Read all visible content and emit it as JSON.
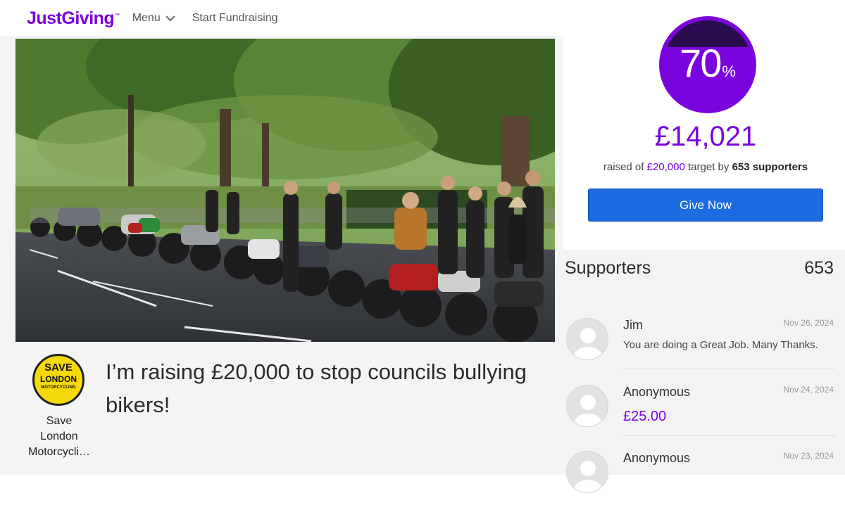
{
  "header": {
    "logo": "JustGiving",
    "logo_tm": "™",
    "menu_label": "Menu",
    "start_label": "Start Fundraising"
  },
  "hero": {
    "image": "group of motorcyclists with motorbikes parked along a tree-lined street"
  },
  "charity": {
    "name_lines": [
      "Save",
      "London",
      "Motorcycli…"
    ],
    "logo_text": [
      "SAVE",
      "LONDON",
      "MOTORCYCLING"
    ]
  },
  "page": {
    "title": "I’m raising £20,000 to stop councils bullying bikers!"
  },
  "progress": {
    "percent": "70",
    "percent_sign": "%",
    "fill_fraction": 0.7,
    "raised": "£14,021",
    "raised_prefix": "raised of",
    "target": "£20,000",
    "middle": "target by",
    "supporters_text": "653 supporters"
  },
  "give_button": "Give Now",
  "supporters": {
    "title": "Supporters",
    "count": "653",
    "items": [
      {
        "name": "Jim",
        "date": "Nov 26, 2024",
        "message": "You are doing a Great Job. Many Thanks.",
        "amount": ""
      },
      {
        "name": "Anonymous",
        "date": "Nov 24, 2024",
        "message": "",
        "amount": "£25.00"
      },
      {
        "name": "Anonymous",
        "date": "Nov 23, 2024",
        "message": "",
        "amount": ""
      }
    ]
  },
  "colors": {
    "brand": "#7a04dd",
    "button": "#1d6be0",
    "progress_dark": "#2a0d4f"
  },
  "icons": [
    "chevron-down-icon",
    "user-avatar-icon"
  ]
}
